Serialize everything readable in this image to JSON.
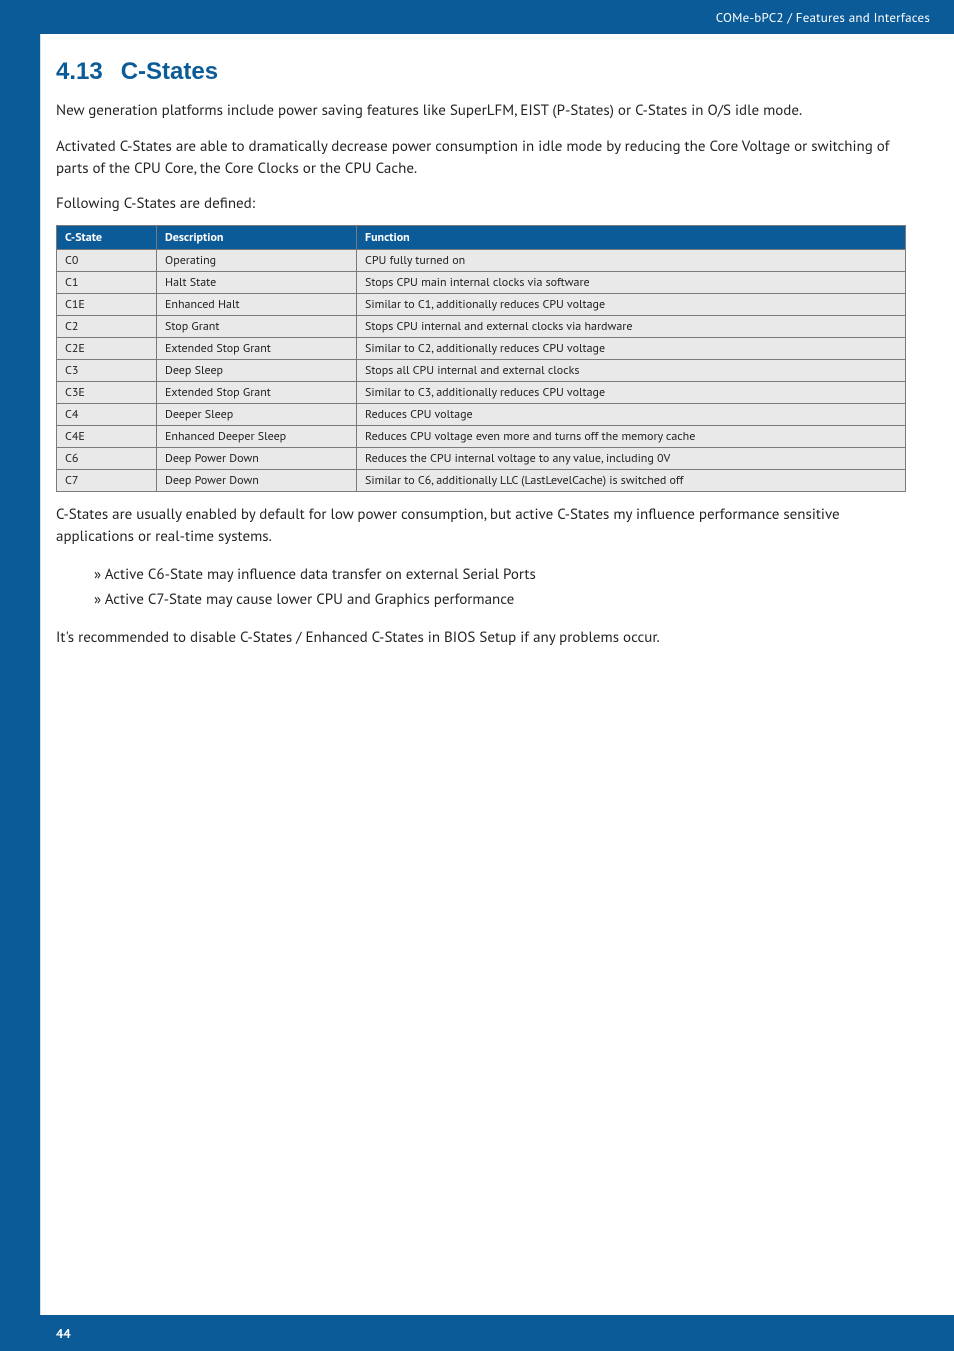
{
  "header": {
    "breadcrumb": "COMe-bPC2 / Features and Interfaces"
  },
  "section": {
    "number": "4.13",
    "title": "C-States"
  },
  "paragraphs": {
    "p1": "New generation platforms include power saving features like SuperLFM, EIST (P-States) or C-States in O/S idle mode.",
    "p2": "Activated C-States are able to dramatically decrease power consumption in idle mode by reducing the Core Voltage or switching of parts of the CPU Core, the Core Clocks or the CPU Cache.",
    "p3": "Following C-States are defined:",
    "p4": "C-States are usually enabled by default for low power consumption, but active C-States my influence performance sensitive applications or real-time systems.",
    "p5": "It's recommended to disable C-States / Enhanced C-States in BIOS Setup if any problems occur."
  },
  "bullets": {
    "b1": "Active C6-State may influence data transfer on external Serial Ports",
    "b2": "Active C7-State may cause lower CPU and Graphics performance"
  },
  "table": {
    "headers": {
      "h1": "C-State",
      "h2": "Description",
      "h3": "Function"
    },
    "rows": [
      {
        "c": "C0",
        "d": "Operating",
        "f": "CPU fully turned on"
      },
      {
        "c": "C1",
        "d": "Halt State",
        "f": "Stops CPU main internal clocks via software"
      },
      {
        "c": "C1E",
        "d": "Enhanced Halt",
        "f": "Similar to C1, additionally reduces CPU voltage"
      },
      {
        "c": "C2",
        "d": "Stop Grant",
        "f": "Stops CPU internal and external clocks via hardware"
      },
      {
        "c": "C2E",
        "d": "Extended Stop Grant",
        "f": "Similar to C2, additionally reduces CPU voltage"
      },
      {
        "c": "C3",
        "d": "Deep Sleep",
        "f": "Stops all CPU internal and external clocks"
      },
      {
        "c": "C3E",
        "d": "Extended Stop Grant",
        "f": "Similar to C3, additionally reduces CPU voltage"
      },
      {
        "c": "C4",
        "d": "Deeper Sleep",
        "f": "Reduces CPU voltage"
      },
      {
        "c": "C4E",
        "d": "Enhanced Deeper Sleep",
        "f": "Reduces CPU voltage even more and turns off the memory cache"
      },
      {
        "c": "C6",
        "d": "Deep Power Down",
        "f": "Reduces the CPU internal voltage to any value, including 0V"
      },
      {
        "c": "C7",
        "d": "Deep Power Down",
        "f": "Similar to C6, additionally LLC (LastLevelCache) is switched off"
      }
    ]
  },
  "footer": {
    "page": "44"
  }
}
